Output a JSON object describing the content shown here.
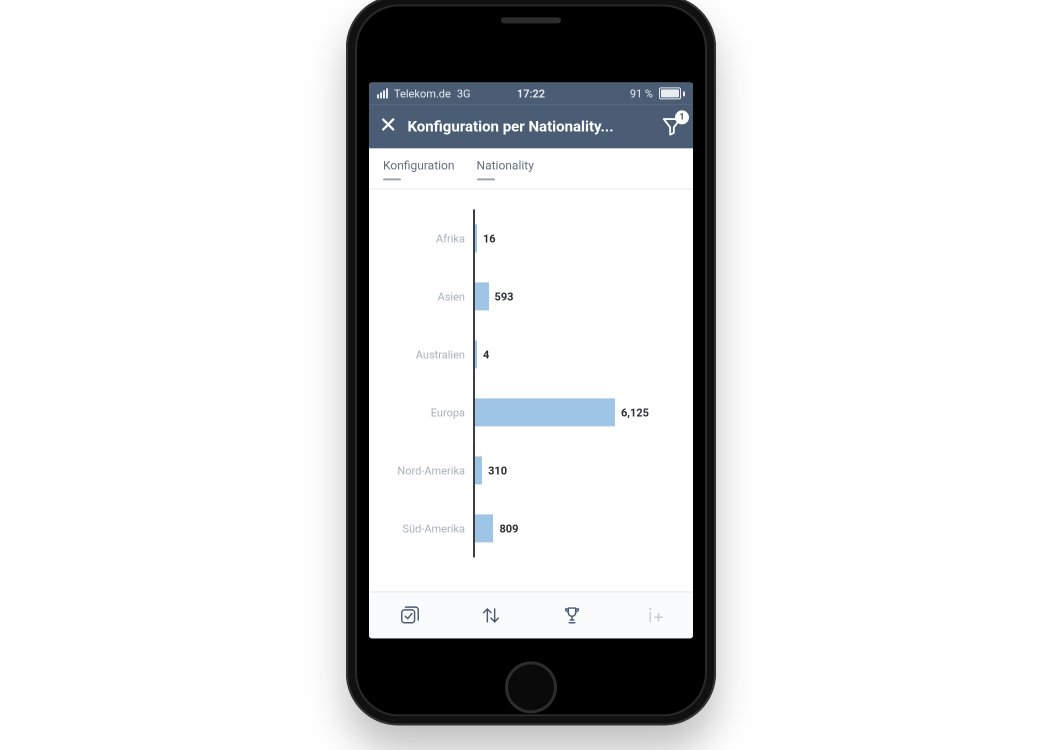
{
  "statusbar": {
    "carrier": "Telekom.de",
    "network": "3G",
    "time": "17:22",
    "battery_text": "91 %"
  },
  "header": {
    "title": "Konfiguration per Nationality...",
    "filter_badge": "1"
  },
  "filter_labels": {
    "a": "Konfiguration",
    "b": "Nationality"
  },
  "chart_data": {
    "type": "bar",
    "orientation": "horizontal",
    "title": "Konfiguration per Nationality",
    "xlabel": "",
    "ylabel": "",
    "categories": [
      "Afrika",
      "Asien",
      "Australien",
      "Europa",
      "Nord-Amerika",
      "Süd-Amerika"
    ],
    "values": [
      16,
      593,
      4,
      6125,
      310,
      809
    ],
    "display_values": [
      "16",
      "593",
      "4",
      "6,125",
      "310",
      "809"
    ],
    "xlim": [
      0,
      7000
    ]
  },
  "colors": {
    "header_bg": "#4a5d74",
    "bar_fill": "#9ec5e6",
    "axis": "#3a3f47",
    "muted_text": "#a8b0ba"
  },
  "toolbar": {
    "multiselect": "multiselect",
    "sort": "sort",
    "rank": "rank",
    "add": "add"
  }
}
